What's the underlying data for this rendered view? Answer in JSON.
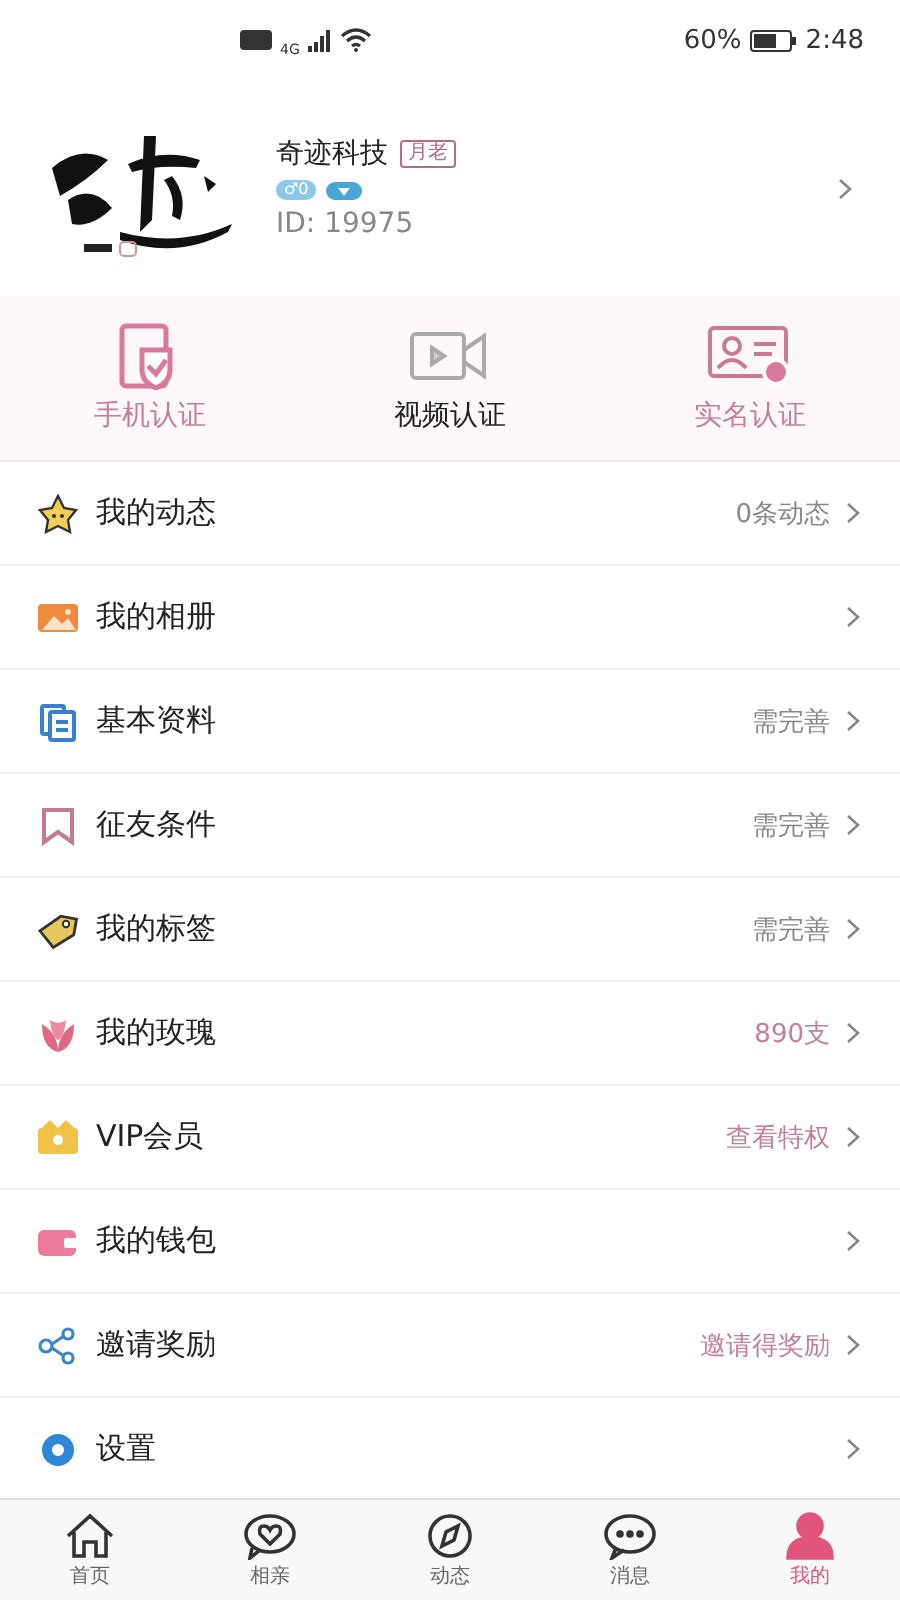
{
  "status_bar": {
    "network": "4G",
    "battery_text": "60%",
    "time": "2:48"
  },
  "profile": {
    "name": "奇迹科技",
    "tag": "月老",
    "badges": [
      "♂0"
    ],
    "id": "ID: 19975"
  },
  "verifications": [
    {
      "label": "手机认证",
      "kind": "phone",
      "verified": true
    },
    {
      "label": "视频认证",
      "kind": "video",
      "verified": false
    },
    {
      "label": "实名认证",
      "kind": "idcard",
      "verified": true
    }
  ],
  "menu": [
    {
      "kind": "moments",
      "label": "我的动态",
      "value": "0条动态",
      "highlight": false
    },
    {
      "kind": "album",
      "label": "我的相册"
    },
    {
      "kind": "profile",
      "label": "基本资料",
      "value": "需完善",
      "highlight": false
    },
    {
      "kind": "criteria",
      "label": "征友条件",
      "value": "需完善",
      "highlight": false
    },
    {
      "kind": "tags",
      "label": "我的标签",
      "value": "需完善",
      "highlight": false
    },
    {
      "kind": "roses",
      "label": "我的玫瑰",
      "value": "890支",
      "highlight": true
    },
    {
      "kind": "vip",
      "label": "VIP会员",
      "value": "查看特权",
      "highlight": true
    },
    {
      "kind": "wallet",
      "label": "我的钱包"
    },
    {
      "kind": "invite",
      "label": "邀请奖励",
      "value": "邀请得奖励",
      "highlight": true
    },
    {
      "kind": "settings",
      "label": "设置"
    }
  ],
  "tabs": [
    {
      "kind": "home",
      "label": "首页",
      "selected": false
    },
    {
      "kind": "match",
      "label": "相亲",
      "selected": false
    },
    {
      "kind": "discover",
      "label": "动态",
      "selected": false
    },
    {
      "kind": "messages",
      "label": "消息",
      "selected": false
    },
    {
      "kind": "me",
      "label": "我的",
      "selected": true
    }
  ]
}
